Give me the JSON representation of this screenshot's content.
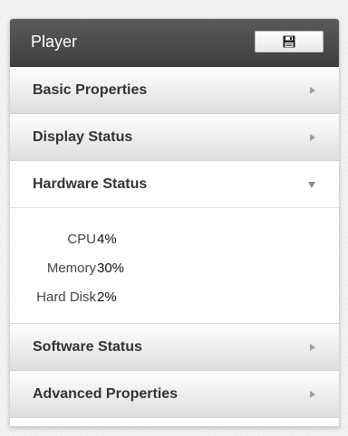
{
  "panel": {
    "title": "Player",
    "save_icon": "save-icon"
  },
  "sections": [
    {
      "label": "Basic Properties",
      "state": "collapsed"
    },
    {
      "label": "Display Status",
      "state": "collapsed"
    },
    {
      "label": "Hardware Status",
      "state": "expanded"
    },
    {
      "label": "Software Status",
      "state": "collapsed"
    },
    {
      "label": "Advanced Properties",
      "state": "collapsed"
    }
  ],
  "hardware": {
    "rows": [
      {
        "label": "CPU",
        "value": "4%"
      },
      {
        "label": "Memory",
        "value": "30%"
      },
      {
        "label": "Hard Disk",
        "value": "2%"
      }
    ]
  },
  "colors": {
    "header_bg": "#4a4a4a",
    "header_text": "#ffffff",
    "section_bg": "#dedede",
    "text": "#333333"
  }
}
